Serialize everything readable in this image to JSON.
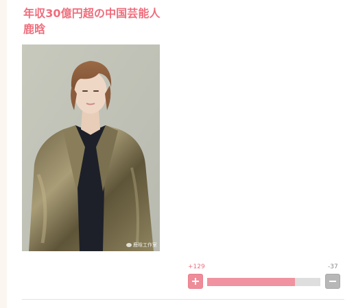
{
  "article": {
    "title_line1": "年収30億円超の中国芸能人",
    "title_line2": "鹿晗",
    "photo_watermark": "鹿晗工作室"
  },
  "vote": {
    "plus_count": "+129",
    "minus_count": "-37",
    "plus_fraction": 0.777,
    "plus_color": "#ee8c9a",
    "minus_color": "#b7b7b7"
  },
  "colors": {
    "title": "#ef6d7c",
    "left_strip": "#fbf6ef"
  }
}
